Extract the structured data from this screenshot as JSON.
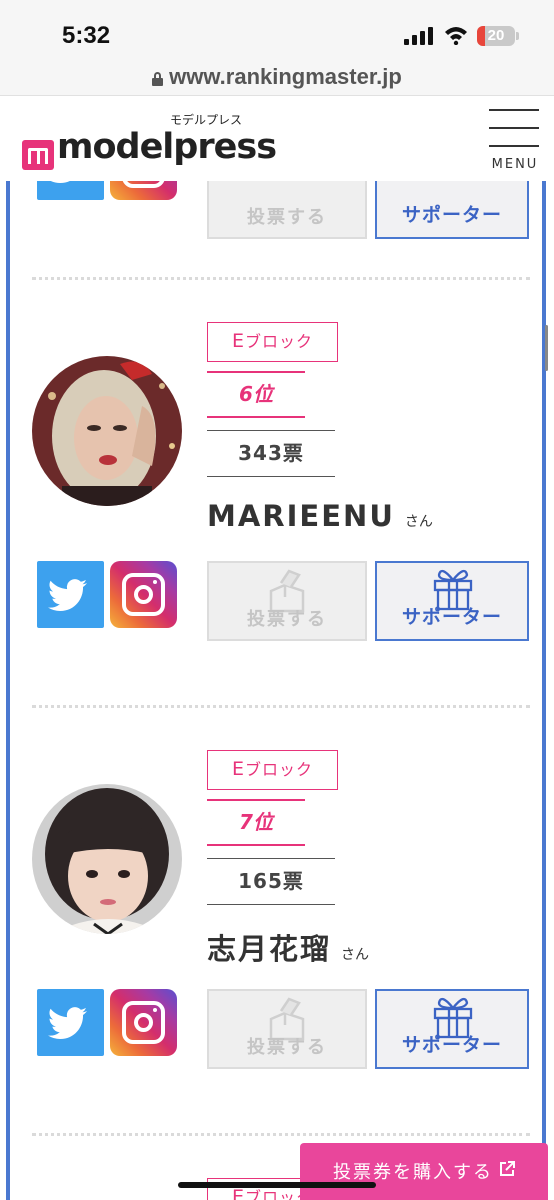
{
  "status_bar": {
    "time": "5:32",
    "battery": "20",
    "battery_level": 0.2
  },
  "browser": {
    "url": "www.rankingmaster.jp"
  },
  "header": {
    "logo_kana": "モデルプレス",
    "logo_text": "modelpress",
    "menu_label": "MENU"
  },
  "entries": [
    {
      "vote_label": "投票する",
      "supporter_label": "サポーター"
    },
    {
      "block_letter": "E",
      "block_suffix": "ブロック",
      "rank": "6位",
      "votes": "343票",
      "name": "MARIEENU",
      "honorific": "さん",
      "vote_label": "投票する",
      "supporter_label": "サポーター"
    },
    {
      "block_letter": "E",
      "block_suffix": "ブロック",
      "rank": "7位",
      "votes": "165票",
      "name": "志月花瑠",
      "honorific": "さん",
      "vote_label": "投票する",
      "supporter_label": "サポーター"
    },
    {
      "block_letter": "E",
      "block_suffix": "ブロック"
    }
  ],
  "footer_cta": {
    "buy_label": "投票券を購入する"
  },
  "colors": {
    "accent_pink": "#e7337a",
    "accent_blue": "#4a78d0",
    "twitter": "#3da1ee",
    "cta": "#e9469b"
  }
}
